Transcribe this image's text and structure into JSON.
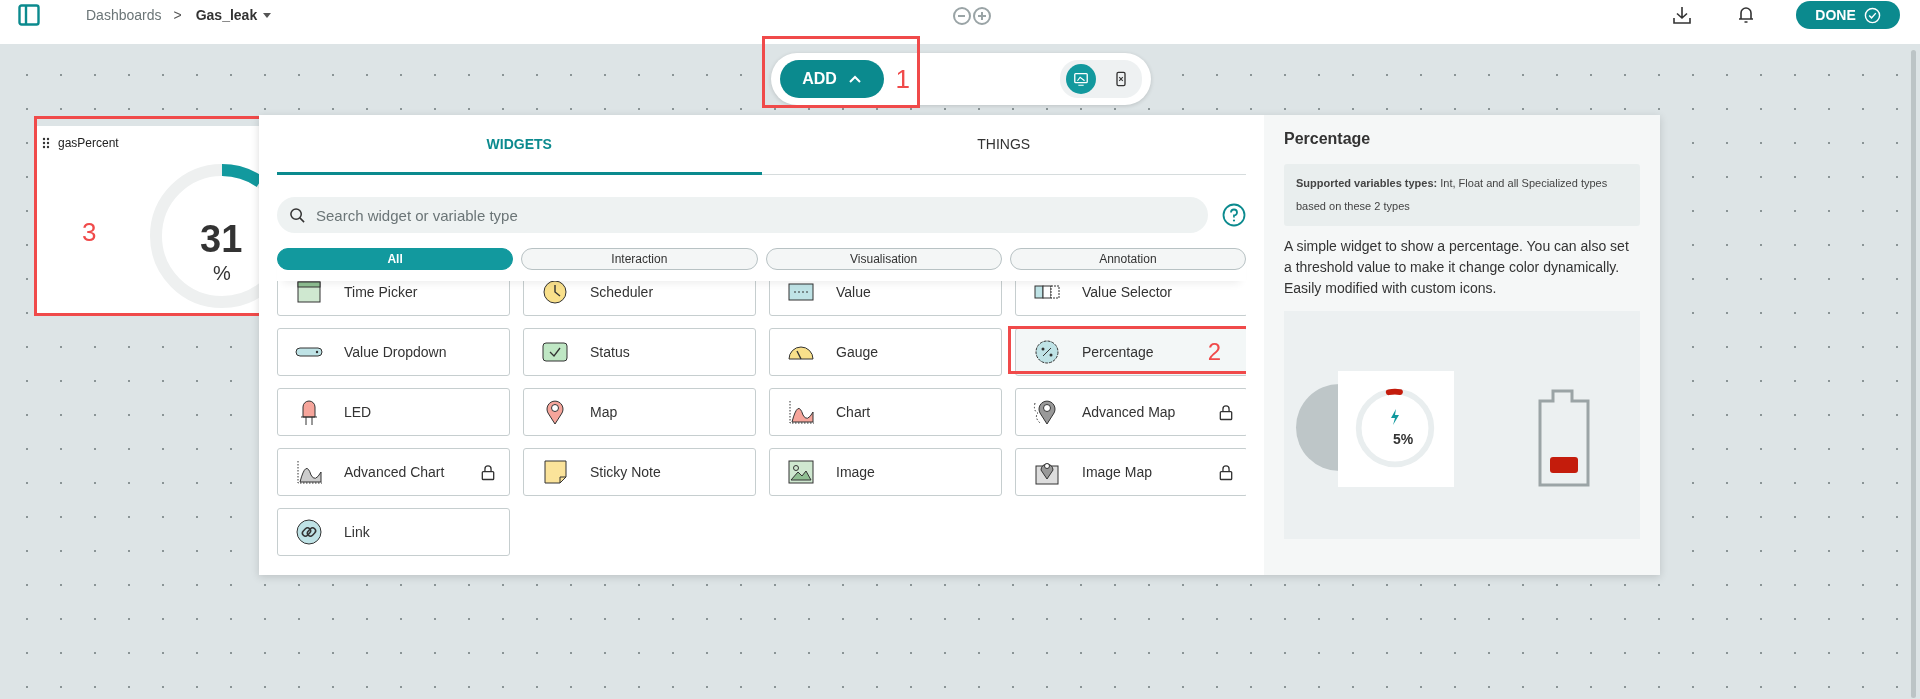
{
  "top_bar": {
    "breadcrumb": "Dashboards",
    "separator": ">",
    "title": "Gas_leak",
    "done_button": "DONE"
  },
  "toolbar": {
    "add_button": "ADD",
    "annotation": "1",
    "view_modes": [
      {
        "kind": "desktop",
        "selected": true
      },
      {
        "kind": "mobile",
        "selected": false
      }
    ]
  },
  "dashboard_widget": {
    "name": "gasPercent",
    "value": "31",
    "unit": "%",
    "annotation": "3"
  },
  "widget_panel": {
    "tabs": [
      {
        "label": "WIDGETS",
        "selected": true
      },
      {
        "label": "THINGS",
        "selected": false
      }
    ],
    "search": {
      "placeholder": "Search widget or variable type"
    },
    "filters": [
      {
        "label": "All",
        "selected": true
      },
      {
        "label": "Interaction",
        "selected": false
      },
      {
        "label": "Visualisation",
        "selected": false
      },
      {
        "label": "Annotation",
        "selected": false
      }
    ],
    "widgets": [
      {
        "label": "Time Picker",
        "kind": "time_picker",
        "locked": false,
        "selected": false
      },
      {
        "label": "Scheduler",
        "kind": "scheduler",
        "locked": false,
        "selected": false
      },
      {
        "label": "Value",
        "kind": "value",
        "locked": false,
        "selected": false
      },
      {
        "label": "Value Selector",
        "kind": "value_selector",
        "locked": false,
        "selected": false
      },
      {
        "label": "Value Dropdown",
        "kind": "dropdown",
        "locked": false,
        "selected": false
      },
      {
        "label": "Status",
        "kind": "status",
        "locked": false,
        "selected": false
      },
      {
        "label": "Gauge",
        "kind": "gauge",
        "locked": false,
        "selected": false
      },
      {
        "label": "Percentage",
        "kind": "percentage",
        "locked": false,
        "selected": true,
        "annotation": "2"
      },
      {
        "label": "LED",
        "kind": "led",
        "locked": false,
        "selected": false
      },
      {
        "label": "Map",
        "kind": "map",
        "locked": false,
        "selected": false
      },
      {
        "label": "Chart",
        "kind": "chart",
        "locked": false,
        "selected": false
      },
      {
        "label": "Advanced Map",
        "kind": "advanced_map",
        "locked": true,
        "selected": false
      },
      {
        "label": "Advanced Chart",
        "kind": "advanced_chart",
        "locked": true,
        "selected": false
      },
      {
        "label": "Sticky Note",
        "kind": "sticky_note",
        "locked": false,
        "selected": false
      },
      {
        "label": "Image",
        "kind": "image",
        "locked": false,
        "selected": false
      },
      {
        "label": "Image Map",
        "kind": "image_map",
        "locked": true,
        "selected": false
      },
      {
        "label": "Link",
        "kind": "link",
        "locked": false,
        "selected": false
      }
    ]
  },
  "details": {
    "title": "Percentage",
    "supported_types": "**Supported variables types:** Int, Float and all Specialized types based on these 2 types",
    "description": "A simple widget to show a percentage. You can also set a threshold value to make it change color dynamically. Easily modified with custom icons.",
    "preview": {
      "value": "5%",
      "level": 0.05
    }
  }
}
